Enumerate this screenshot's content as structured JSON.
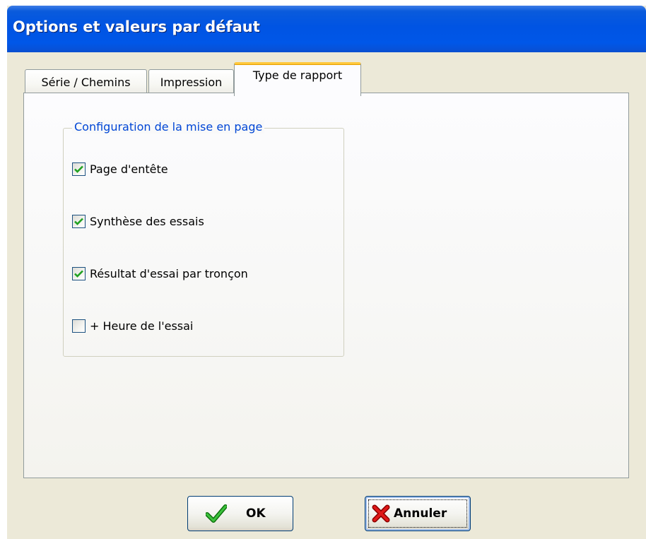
{
  "window": {
    "title": "Options et valeurs par défaut"
  },
  "tabs": [
    {
      "label": "Série / Chemins",
      "active": false
    },
    {
      "label": "Impression",
      "active": false
    },
    {
      "label": "Type de rapport",
      "active": true
    }
  ],
  "group": {
    "label": "Configuration de la mise en page",
    "options": [
      {
        "label": "Page d'entête",
        "checked": true
      },
      {
        "label": "Synthèse des essais",
        "checked": true
      },
      {
        "label": "Résultat d'essai par tronçon",
        "checked": true
      },
      {
        "label": "+ Heure de l'essai",
        "checked": false
      }
    ]
  },
  "buttons": {
    "ok_label": "OK",
    "ok_icon": "green-checkmark-icon",
    "cancel_label": "Annuler",
    "cancel_icon": "red-x-icon"
  },
  "colors": {
    "titlebar": "#0054e3",
    "group_label": "#0046d5",
    "active_tab_accent": "#ffc83c",
    "check_mark": "#21a121",
    "cancel_x": "#d01010"
  }
}
